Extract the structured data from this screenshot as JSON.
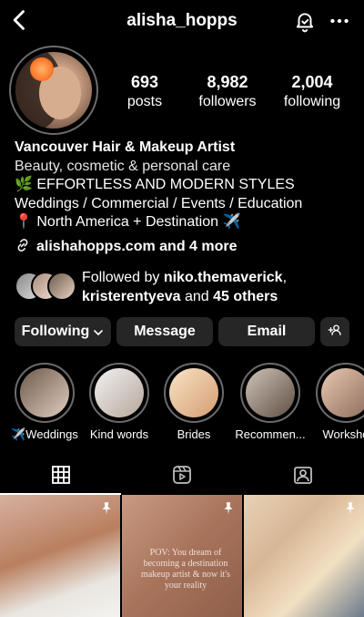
{
  "header": {
    "username": "alisha_hopps",
    "icons": [
      "back-icon",
      "notification-bell-icon",
      "more-icon"
    ]
  },
  "profile": {
    "stats": {
      "posts": {
        "value": "693",
        "label": "posts"
      },
      "followers": {
        "value": "8,982",
        "label": "followers"
      },
      "following": {
        "value": "2,004",
        "label": "following"
      }
    },
    "bio": {
      "name_title": "Vancouver Hair & Makeup Artist",
      "category": "Beauty, cosmetic & personal care",
      "lines": [
        "🌿 EFFORTLESS AND MODERN STYLES",
        "Weddings / Commercial / Events / Education",
        "📍 North America + Destination ✈️"
      ],
      "link_text": "alishahopps.com and 4 more"
    },
    "mutual": {
      "prefix": "Followed by ",
      "user1": "niko.themaverick",
      "sep": ",",
      "user2": "kristerentyeva",
      "mid": " and ",
      "others": "45 others"
    }
  },
  "actions": {
    "following_label": "Following",
    "message_label": "Message",
    "email_label": "Email",
    "add_user_icon": "add-user-icon"
  },
  "highlights": [
    {
      "label": "✈️Weddings"
    },
    {
      "label": "Kind words"
    },
    {
      "label": "Brides"
    },
    {
      "label": "Recommen..."
    },
    {
      "label": "Worksho"
    }
  ],
  "tabs": [
    {
      "icon": "grid-icon",
      "active": true
    },
    {
      "icon": "reels-icon",
      "active": false
    },
    {
      "icon": "tagged-icon",
      "active": false
    }
  ],
  "posts": [
    {
      "pinned": true
    },
    {
      "pinned": true,
      "overlay_text": "POV: You dream of becoming a destination makeup artist & now it's your reality"
    },
    {
      "pinned": true
    }
  ],
  "colors": {
    "background": "#000000",
    "button": "#262626",
    "text": "#ffffff"
  }
}
